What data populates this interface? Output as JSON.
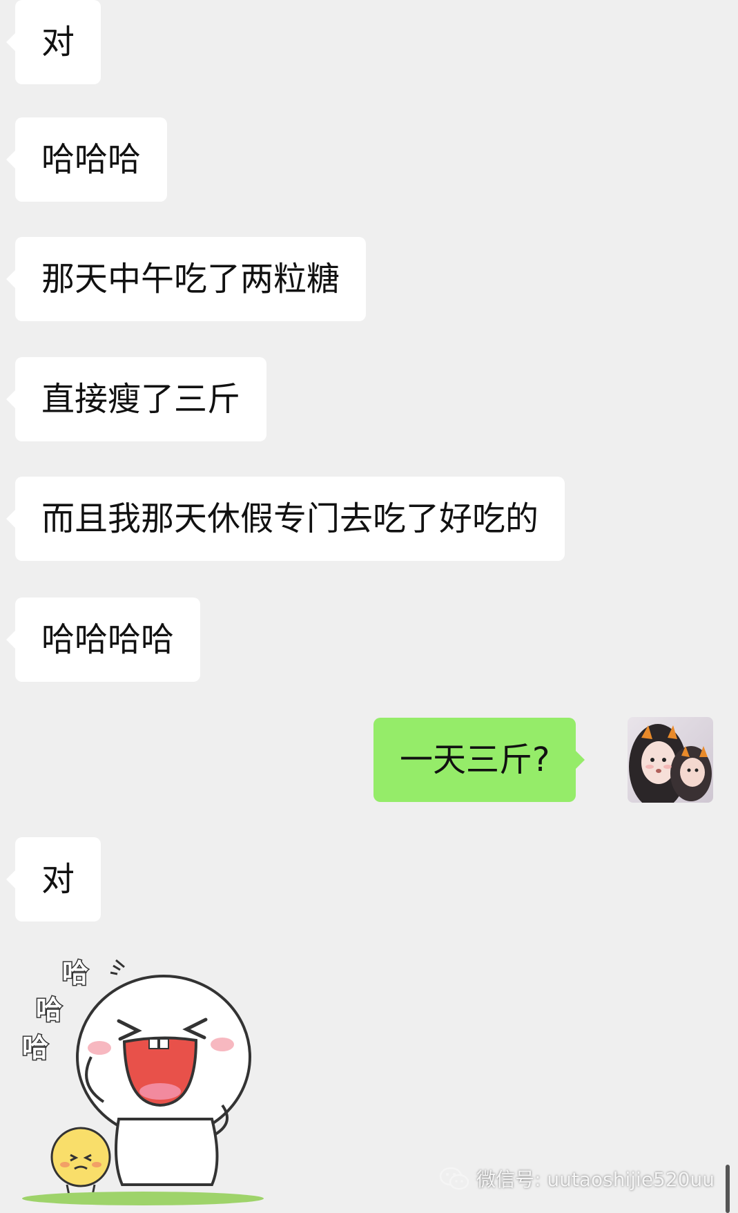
{
  "colors": {
    "background": "#efefef",
    "incoming_bubble": "#ffffff",
    "outgoing_bubble": "#95ec69",
    "text": "#111111"
  },
  "messages": [
    {
      "direction": "in",
      "text": "对"
    },
    {
      "direction": "in",
      "text": "哈哈哈"
    },
    {
      "direction": "in",
      "text": "那天中午吃了两粒糖"
    },
    {
      "direction": "in",
      "text": "直接瘦了三斤"
    },
    {
      "direction": "in",
      "text": "而且我那天休假专门去吃了好吃的"
    },
    {
      "direction": "in",
      "text": "哈哈哈哈"
    },
    {
      "direction": "out",
      "text": "一天三斤?"
    },
    {
      "direction": "in",
      "text": "对"
    }
  ],
  "sticker": {
    "chars": [
      "哈",
      "哈",
      "哈"
    ]
  },
  "avatar": {
    "icon": "user-avatar-photo"
  },
  "watermark": {
    "text": "微信号: uutaoshijie520uu",
    "icon": "wechat-icon"
  }
}
